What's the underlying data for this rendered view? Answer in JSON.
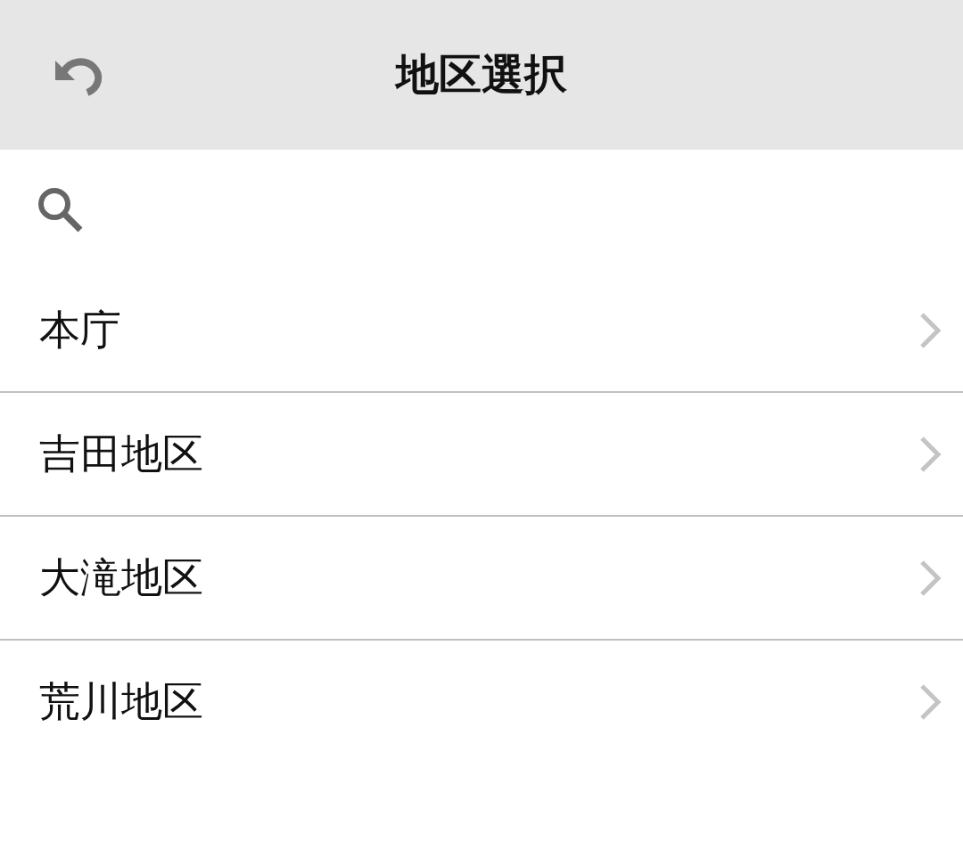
{
  "header": {
    "title": "地区選択"
  },
  "districts": [
    {
      "label": "本庁"
    },
    {
      "label": "吉田地区"
    },
    {
      "label": "大滝地区"
    },
    {
      "label": "荒川地区"
    }
  ]
}
